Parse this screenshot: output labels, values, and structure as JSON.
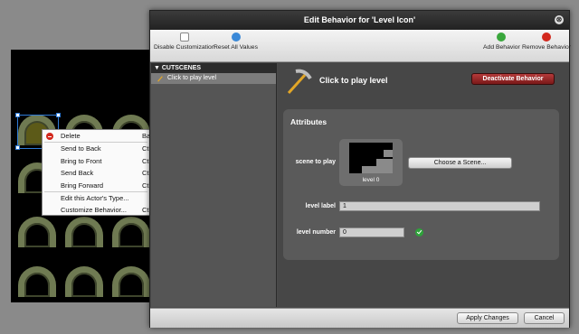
{
  "dialog": {
    "title": "Edit Behavior for 'Level Icon'",
    "close_glyph": "⊗"
  },
  "toolbar": {
    "disable_label": "Disable Customization",
    "reset_label": "Reset All Values",
    "add_label": "Add Behavior",
    "remove_label": "Remove Behavior"
  },
  "tree": {
    "section_label": "▼ CUTSCENES",
    "item_label": "Click to play level"
  },
  "behavior": {
    "title": "Click to play level",
    "deactivate_label": "Deactivate Behavior"
  },
  "attributes": {
    "heading": "Attributes",
    "scene_label": "scene to play",
    "scene_caption": "level 0",
    "choose_scene_label": "Choose a Scene...",
    "level_label_label": "level label",
    "level_label_value": "1",
    "level_number_label": "level number",
    "level_number_value": "0"
  },
  "footer": {
    "apply_label": "Apply Changes",
    "cancel_label": "Cancel"
  },
  "context_menu": {
    "items": [
      {
        "label": "Delete",
        "shortcut": "Ba"
      },
      {
        "label": "Send to Back",
        "shortcut": "Ct"
      },
      {
        "label": "Bring to Front",
        "shortcut": "Ct"
      },
      {
        "label": "Send Back",
        "shortcut": "Ct"
      },
      {
        "label": "Bring Forward",
        "shortcut": "Ct"
      },
      {
        "label": "Edit this Actor's Type...",
        "shortcut": ""
      },
      {
        "label": "Customize Behavior...",
        "shortcut": "Ct"
      }
    ]
  },
  "colors": {
    "deactivate": "#9b2a2a",
    "accent_blue": "#3a89d8",
    "add_green": "#3aa73c",
    "remove_red": "#d2281d",
    "valid_green": "#2ea33a"
  },
  "icons": [
    "disable-icon",
    "reset-icon",
    "add-icon",
    "remove-icon",
    "pickaxe-icon",
    "delete-icon",
    "check-icon",
    "close-icon"
  ]
}
